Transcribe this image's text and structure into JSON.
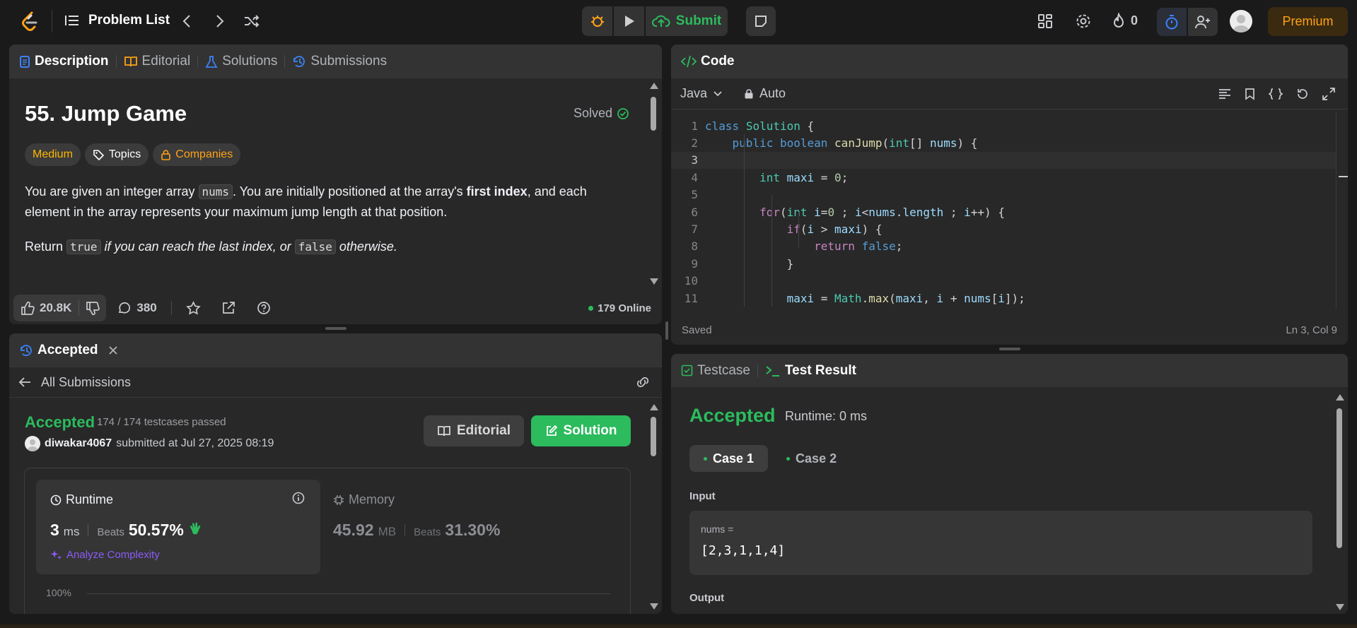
{
  "topbar": {
    "problem_list": "Problem List",
    "submit": "Submit",
    "streak": "0",
    "premium": "Premium"
  },
  "desc_panel": {
    "tabs": [
      "Description",
      "Editorial",
      "Solutions",
      "Submissions"
    ],
    "title": "55. Jump Game",
    "solved": "Solved",
    "tags": {
      "difficulty": "Medium",
      "topics": "Topics",
      "companies": "Companies"
    },
    "p1": {
      "a": "You are given an integer array ",
      "code": "nums",
      "b": ". You are initially positioned at the array's ",
      "bold": "first index",
      "c": ", and each element in the array represents your maximum jump length at that position."
    },
    "p2": {
      "a": "Return ",
      "code1": "true",
      "b": " if you can reach the last index, or ",
      "code2": "false",
      "c": " otherwise."
    },
    "likes": "20.8K",
    "comments": "380",
    "online": "179 Online"
  },
  "sub_panel": {
    "tab": "Accepted",
    "all_submissions": "All Submissions",
    "status": "Accepted",
    "passed": "174 / 174 testcases passed",
    "user": "diwakar4067",
    "submitted": "submitted at Jul 27, 2025 08:19",
    "editorial_btn": "Editorial",
    "solution_btn": "Solution",
    "runtime": {
      "label": "Runtime",
      "value": "3",
      "unit": "ms",
      "beats_label": "Beats",
      "beats": "50.57%",
      "analyze": "Analyze Complexity"
    },
    "memory": {
      "label": "Memory",
      "value": "45.92",
      "unit": "MB",
      "beats_label": "Beats",
      "beats": "31.30%"
    },
    "chart_top": "100%"
  },
  "code_panel": {
    "title": "Code",
    "language": "Java",
    "auto": "Auto",
    "saved": "Saved",
    "cursor": "Ln 3, Col 9",
    "line_numbers": [
      "1",
      "2",
      "3",
      "4",
      "5",
      "6",
      "7",
      "8",
      "9",
      "10",
      "11"
    ]
  },
  "test_panel": {
    "tabs": [
      "Testcase",
      "Test Result"
    ],
    "status": "Accepted",
    "runtime": "Runtime: 0 ms",
    "cases": [
      "Case 1",
      "Case 2"
    ],
    "input_label": "Input",
    "var_name": "nums =",
    "var_value": "[2,3,1,1,4]",
    "output_label": "Output"
  },
  "colors": {
    "accent_green": "#2cbb5d",
    "medium": "#ffb800",
    "premium": "#ffa116",
    "link_blue": "#3b82f6"
  }
}
